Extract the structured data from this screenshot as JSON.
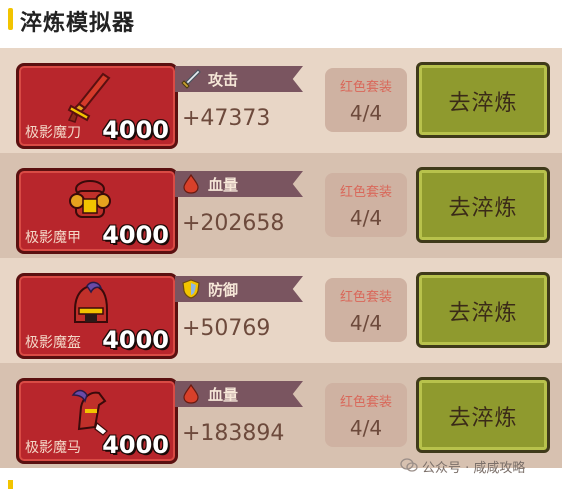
{
  "page_title": "淬炼模拟器",
  "colors": {
    "accent": "#f2c400",
    "card_red": "#b8262c",
    "button_olive": "#8f9a2e",
    "set_label": "#d9685a"
  },
  "rows": [
    {
      "item_name": "极影魔刀",
      "item_icon": "sword-icon",
      "score": "4000",
      "stat_icon": "sword-stat-icon",
      "stat_label": "攻击",
      "stat_value": "+47373",
      "set_label": "红色套装",
      "set_count": "4/4",
      "button_label": "去淬炼"
    },
    {
      "item_name": "极影魔甲",
      "item_icon": "armor-icon",
      "score": "4000",
      "stat_icon": "blood-drop-icon",
      "stat_label": "血量",
      "stat_value": "+202658",
      "set_label": "红色套装",
      "set_count": "4/4",
      "button_label": "去淬炼"
    },
    {
      "item_name": "极影魔盔",
      "item_icon": "helmet-icon",
      "score": "4000",
      "stat_icon": "shield-icon",
      "stat_label": "防御",
      "stat_value": "+50769",
      "set_label": "红色套装",
      "set_count": "4/4",
      "button_label": "去淬炼"
    },
    {
      "item_name": "极影魔马",
      "item_icon": "horse-icon",
      "score": "4000",
      "stat_icon": "blood-drop-icon",
      "stat_label": "血量",
      "stat_value": "+183894",
      "set_label": "红色套装",
      "set_count": "4/4",
      "button_label": "去淬炼"
    }
  ],
  "watermark": "公众号 · 咸咸攻略"
}
